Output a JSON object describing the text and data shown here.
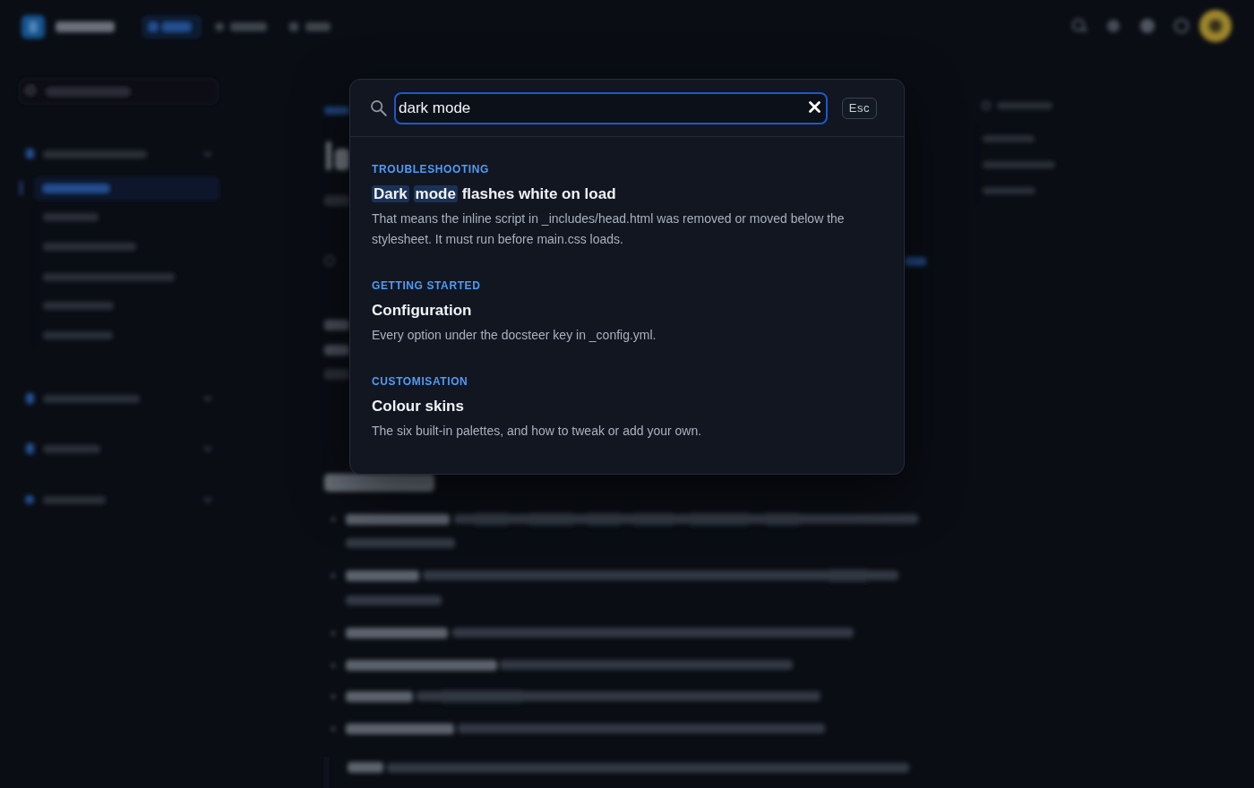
{
  "search_modal": {
    "query": "dark mode",
    "esc_label": "Esc",
    "results": [
      {
        "category": "TROUBLESHOOTING",
        "title": [
          {
            "text": "Dark",
            "highlighted": true
          },
          {
            "text": "mode",
            "highlighted": true
          },
          {
            "text": "flashes white on load",
            "highlighted": false
          }
        ],
        "description": "That means the inline script in _includes/head.html was removed or moved below the stylesheet. It must run before main.css loads."
      },
      {
        "category": "GETTING STARTED",
        "title": [
          {
            "text": "Configuration",
            "highlighted": false
          }
        ],
        "description": "Every option under the docsteer key in _config.yml."
      },
      {
        "category": "CUSTOMISATION",
        "title": [
          {
            "text": "Colour skins",
            "highlighted": false
          }
        ],
        "description": "The six built-in palettes, and how to tweak or add your own."
      }
    ]
  }
}
